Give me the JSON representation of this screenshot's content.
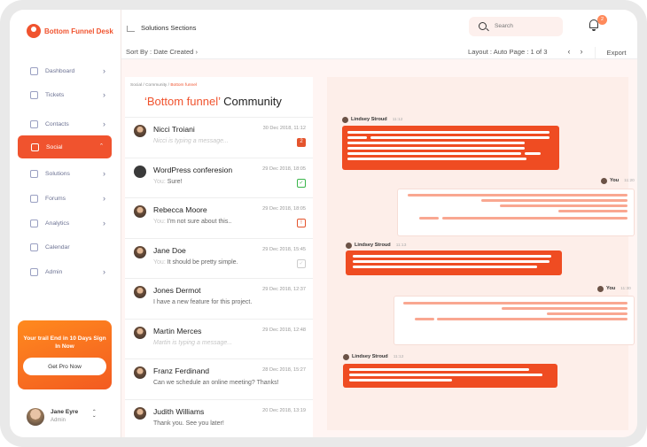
{
  "brand": {
    "name": "Bottom Funnel Desk"
  },
  "sidebar": {
    "items": [
      {
        "label": "Dashboard",
        "has_chevron": true
      },
      {
        "label": "Tickets",
        "has_chevron": true
      },
      {
        "label": "Contacts",
        "has_chevron": true
      },
      {
        "label": "Social",
        "has_chevron": true,
        "active": true
      },
      {
        "label": "Solutions",
        "has_chevron": true
      },
      {
        "label": "Forums",
        "has_chevron": true
      },
      {
        "label": "Analytics",
        "has_chevron": true
      },
      {
        "label": "Calendar",
        "has_chevron": false
      },
      {
        "label": "Admin",
        "has_chevron": true
      }
    ],
    "promo": {
      "text": "Your trail End in 10 Days Sign In Now",
      "button": "Get Pro Now"
    },
    "user": {
      "name": "Jane Eyre",
      "role": "Admin"
    }
  },
  "topbar": {
    "section_title": "Solutions Sections",
    "search_placeholder": "Search",
    "notification_count": "2"
  },
  "subbar": {
    "sort": "Sort By : Date Created",
    "layout": "Layout : Auto  Page : 1 of 3",
    "export": "Export"
  },
  "list": {
    "breadcrumb": {
      "prefix": "Social / Community / ",
      "current": "Bottom funnel"
    },
    "title_highlight": "‘Bottom funnel’",
    "title_rest": " Community",
    "conversations": [
      {
        "name": "Nicci Troiani",
        "date": "30 Dec 2018, 11:12",
        "preview": "Nicci is typing a message...",
        "you": "",
        "typing": true,
        "status": "unread",
        "status_text": "2"
      },
      {
        "name": "WordPress conferesion",
        "date": "29 Dec 2018, 18:05",
        "preview": " Sure!",
        "you": "You:",
        "typing": false,
        "status": "ok",
        "status_text": "✓"
      },
      {
        "name": "Rebecca Moore",
        "date": "29 Dec 2018, 18:05",
        "preview": " I'm not sure about this..",
        "you": "You:",
        "typing": false,
        "status": "err",
        "status_text": "!"
      },
      {
        "name": "Jane Doe",
        "date": "29 Dec 2018, 15:45",
        "preview": " It should be pretty simple.",
        "you": "You:",
        "typing": false,
        "status": "seen",
        "status_text": "✓"
      },
      {
        "name": "Jones Dermot",
        "date": "29 Dec 2018, 12:37",
        "preview": "I have a new feature for this project.",
        "you": "",
        "typing": false,
        "status": "",
        "status_text": ""
      },
      {
        "name": "Martin Merces",
        "date": "29 Dec 2018, 12:48",
        "preview": "Martin is typing a message...",
        "you": "",
        "typing": true,
        "status": "",
        "status_text": ""
      },
      {
        "name": "Franz Ferdinand",
        "date": "28 Dec 2018, 15:27",
        "preview": "Can we schedule an online meeting? Thanks!",
        "you": "",
        "typing": false,
        "status": "",
        "status_text": ""
      },
      {
        "name": "Judith Williams",
        "date": "20 Dec 2018, 13:19",
        "preview": "Thank you. See you later!",
        "you": "",
        "typing": false,
        "status": "",
        "status_text": ""
      }
    ]
  },
  "chat": {
    "messages": [
      {
        "sender": "Lindsey Stroud",
        "time": "11:12",
        "direction": "incoming"
      },
      {
        "sender": "You",
        "time": "11:20",
        "direction": "outgoing"
      },
      {
        "sender": "Lindsey Stroud",
        "time": "11:13",
        "direction": "incoming"
      },
      {
        "sender": "You",
        "time": "11:30",
        "direction": "outgoing"
      },
      {
        "sender": "Lindsey Stroud",
        "time": "11:12",
        "direction": "incoming"
      }
    ]
  },
  "colors": {
    "accent": "#f0532e",
    "chat_bg": "#fdeee9",
    "outgoing_line": "#f9a791"
  }
}
